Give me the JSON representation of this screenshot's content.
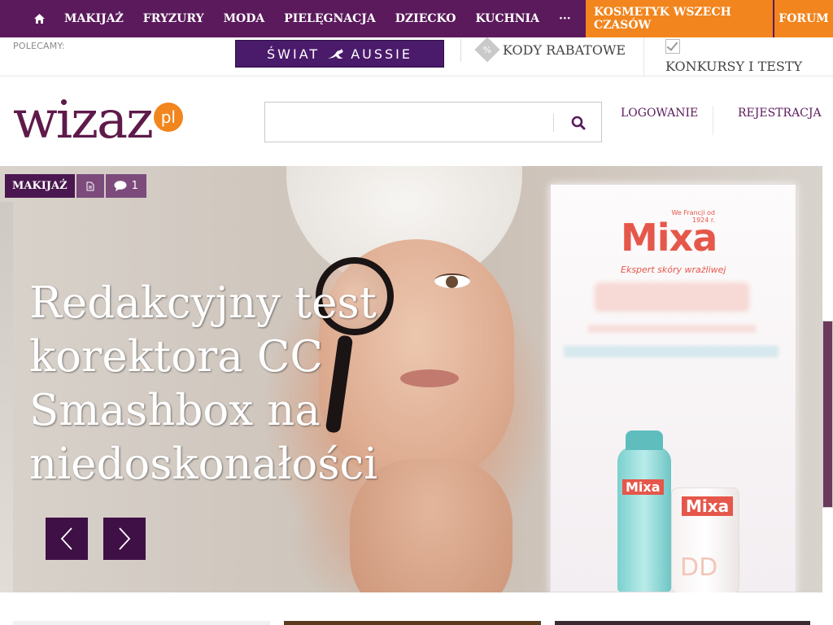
{
  "nav": {
    "home_icon": "home-icon",
    "items": [
      "MAKIJAŻ",
      "FRYZURY",
      "MODA",
      "PIELĘGNACJA",
      "DZIECKO",
      "KUCHNIA",
      "···"
    ],
    "highlight": "KOSMETYK WSZECH CZASÓW",
    "forum": "FORUM",
    "colors": {
      "nav_bg": "#5b1a5c",
      "highlight_bg": "#f2851d"
    }
  },
  "partner": {
    "recommend_label": "POLECAMY:",
    "banner_text_left": "ŚWIAT",
    "banner_text_right": "AUSSIE",
    "coupons": "KODY RABATOWE",
    "contests": "KONKURSY I TESTY"
  },
  "header": {
    "logo_text": "wizaz",
    "logo_suffix": "pl",
    "search_placeholder": "",
    "search_icon": "search-icon",
    "login": "LOGOWANIE",
    "register": "REJESTRACJA"
  },
  "hero": {
    "category": "MAKIJAŻ",
    "comment_count": "1",
    "title": "Redakcyjny test korektora CC Smashbox na niedoskonałości",
    "prev_icon": "chevron-left-icon",
    "next_icon": "chevron-right-icon"
  },
  "ad": {
    "brand": "Mixa",
    "since": "We Francji od 1924 r.",
    "tagline": "Ekspert skóry wrażliwej",
    "product_label_1": "Mixa",
    "product_label_2": "Mixa",
    "product_dd": "DD"
  }
}
